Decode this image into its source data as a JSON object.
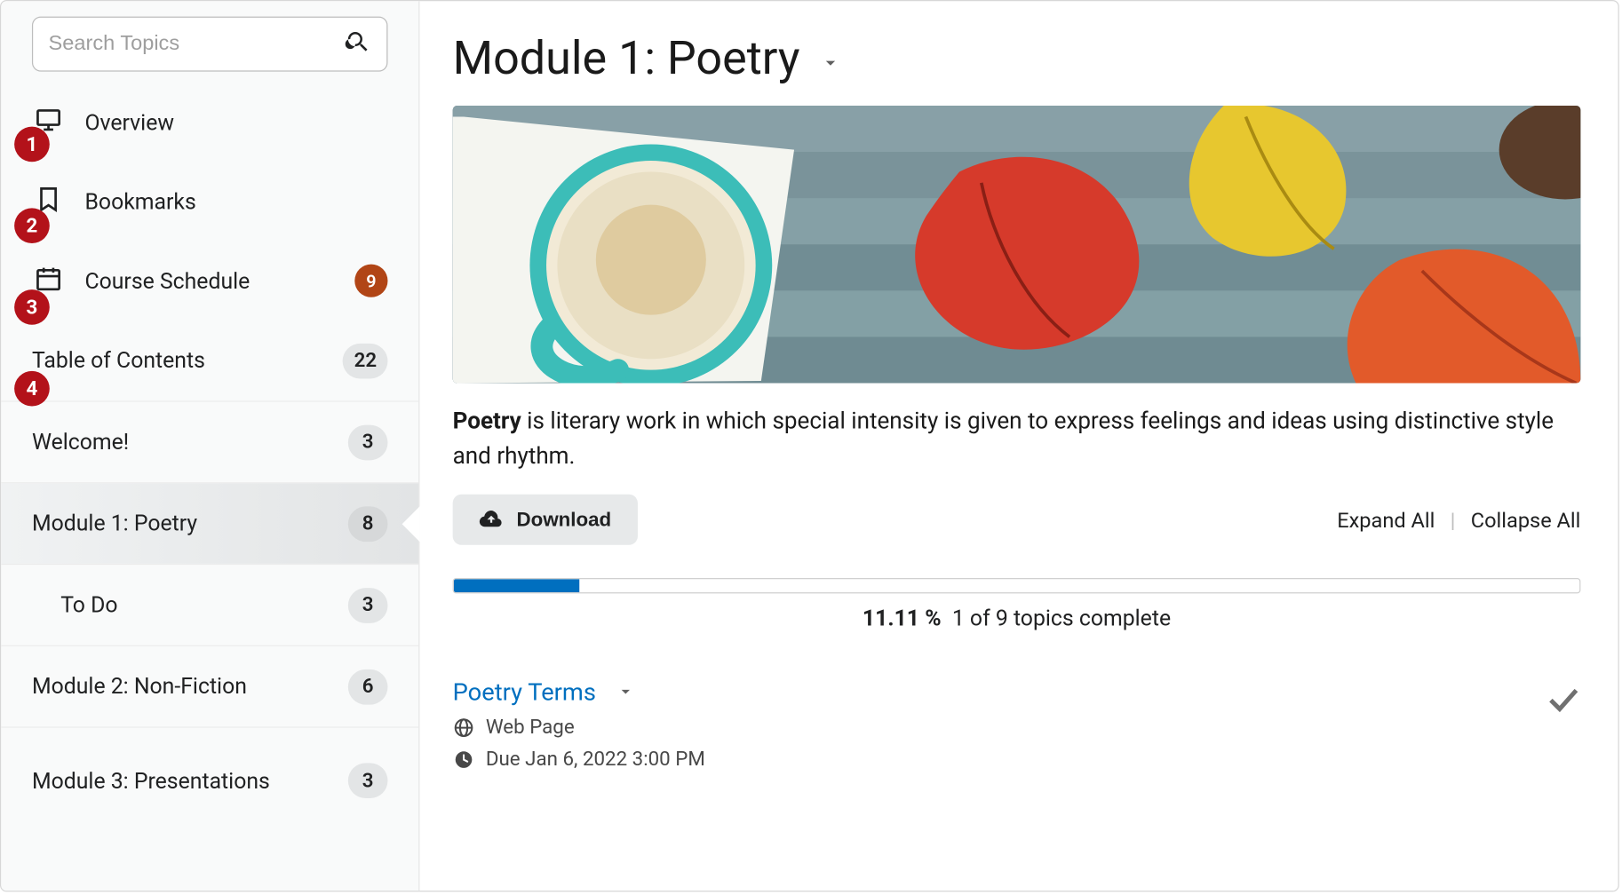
{
  "annotations": [
    "1",
    "2",
    "3",
    "4"
  ],
  "sidebar": {
    "search_placeholder": "Search Topics",
    "nav": [
      {
        "label": "Overview"
      },
      {
        "label": "Bookmarks"
      },
      {
        "label": "Course Schedule",
        "badge": "9"
      }
    ],
    "toc": [
      {
        "label": "Table of Contents",
        "count": "22"
      },
      {
        "label": "Welcome!",
        "count": "3"
      },
      {
        "label": "Module 1: Poetry",
        "count": "8",
        "selected": true
      },
      {
        "label": "To Do",
        "count": "3",
        "sub": true
      },
      {
        "label": "Module 2: Non-Fiction",
        "count": "6"
      },
      {
        "label": "Module 3: Presentations",
        "count": "3",
        "tall": true
      }
    ]
  },
  "main": {
    "title": "Module 1: Poetry",
    "description_bold": "Poetry",
    "description_rest": " is literary work in which special intensity is given to express feelings and ideas using distinctive style and rhythm.",
    "download_label": "Download",
    "expand_label": "Expand All",
    "collapse_label": "Collapse All",
    "progress_percent": "11.11 %",
    "progress_text": "1 of 9 topics complete",
    "progress_fill_pct": 11.11,
    "topic": {
      "title": "Poetry Terms",
      "type": "Web Page",
      "due": "Due Jan 6, 2022 3:00 PM"
    }
  }
}
